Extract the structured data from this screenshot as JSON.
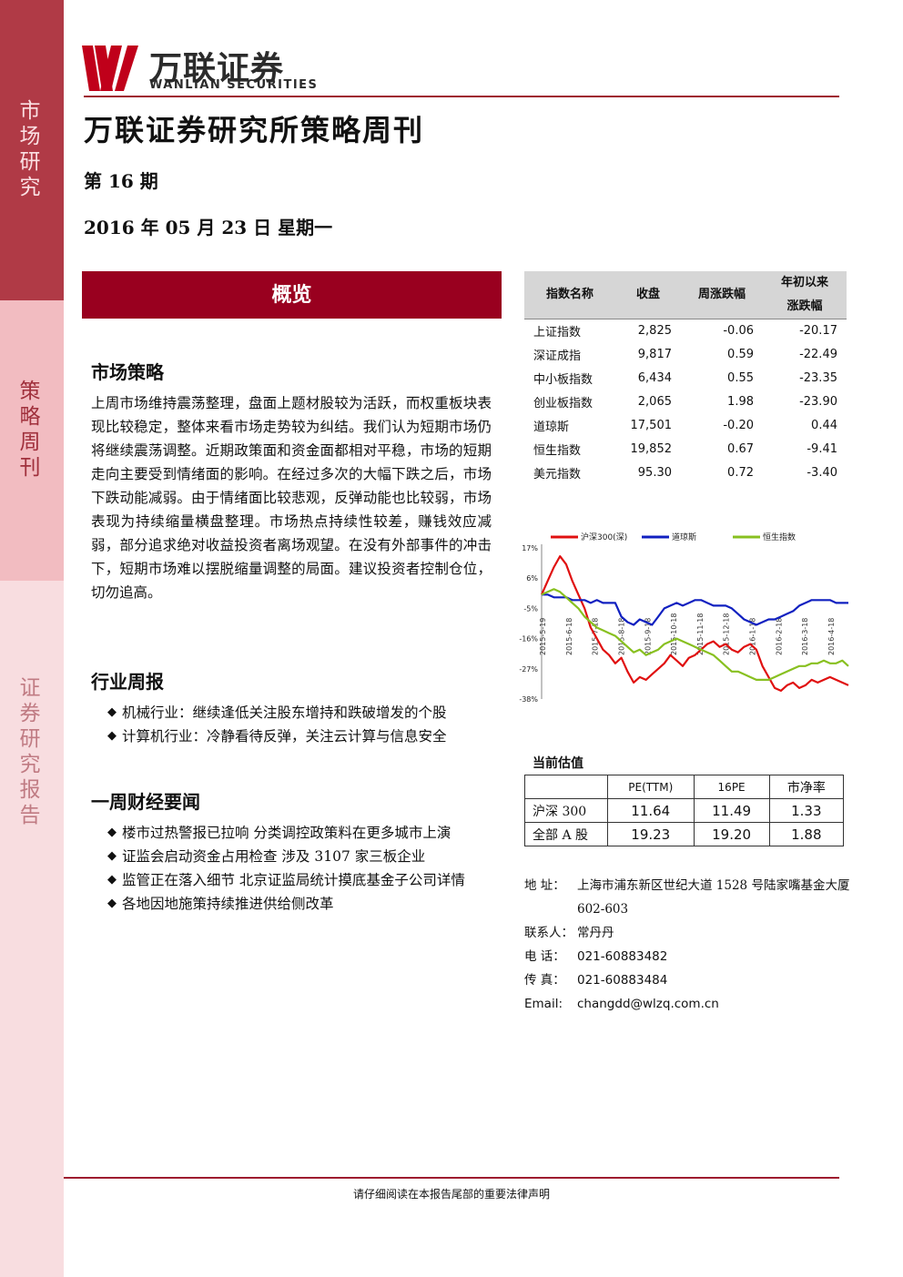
{
  "sidebar": {
    "labels": [
      [
        "市",
        "场",
        "研",
        "究"
      ],
      [
        "策",
        "略",
        "周",
        "刊"
      ],
      [
        "证",
        "券",
        "研",
        "究",
        "报",
        "告"
      ]
    ]
  },
  "header": {
    "brand_cn": "万联证券",
    "brand_en": "WANLIAN SECURITIES",
    "title": "万联证券研究所策略周刊",
    "issue": "第 16 期",
    "date": "2016 年 05 月 23 日  星期一"
  },
  "overview": {
    "banner": "概览"
  },
  "strategy": {
    "heading": "市场策略",
    "text": "上周市场维持震荡整理，盘面上题材股较为活跃，而权重板块表现比较稳定，整体来看市场走势较为纠结。我们认为短期市场仍将继续震荡调整。近期政策面和资金面都相对平稳，市场的短期走向主要受到情绪面的影响。在经过多次的大幅下跌之后，市场下跌动能减弱。由于情绪面比较悲观，反弹动能也比较弱，市场表现为持续缩量横盘整理。市场热点持续性较差，赚钱效应减弱，部分追求绝对收益投资者离场观望。在没有外部事件的冲击下，短期市场难以摆脱缩量调整的局面。建议投资者控制仓位，切勿追高。"
  },
  "industry": {
    "heading": "行业周报",
    "items": [
      "机械行业：继续逢低关注股东增持和跌破增发的个股",
      "计算机行业：冷静看待反弹，关注云计算与信息安全"
    ]
  },
  "news": {
    "heading": "一周财经要闻",
    "items": [
      "楼市过热警报已拉响 分类调控政策料在更多城市上演",
      "证监会启动资金占用检查 涉及 3107 家三板企业",
      "监管正在落入细节 北京证监局统计摸底基金子公司详情",
      "各地因地施策持续推进供给侧改革"
    ]
  },
  "index_table": {
    "headers": [
      "指数名称",
      "收盘",
      "周涨跌幅",
      "年初以来",
      "涨跌幅"
    ],
    "rows": [
      [
        "上证指数",
        "2,825",
        "-0.06",
        "-20.17"
      ],
      [
        "深证成指",
        "9,817",
        "0.59",
        "-22.49"
      ],
      [
        "中小板指数",
        "6,434",
        "0.55",
        "-23.35"
      ],
      [
        "创业板指数",
        "2,065",
        "1.98",
        "-23.90"
      ],
      [
        "道琼斯",
        "17,501",
        "-0.20",
        "0.44"
      ],
      [
        "恒生指数",
        "19,852",
        "0.67",
        "-9.41"
      ],
      [
        "美元指数",
        "95.30",
        "0.72",
        "-3.40"
      ]
    ]
  },
  "chart_data": {
    "type": "line",
    "y_ticks": [
      "17%",
      "6%",
      "-5%",
      "-16%",
      "-27%",
      "-38%"
    ],
    "ylim": [
      -38,
      17
    ],
    "x_ticks": [
      "2015-5-19",
      "2015-6-18",
      "2015-7-18",
      "2015-8-18",
      "2015-9-18",
      "2015-10-18",
      "2015-11-18",
      "2015-12-18",
      "2016-1-18",
      "2016-2-18",
      "2016-3-18",
      "2016-4-18"
    ],
    "series": [
      {
        "name": "沪深300(深)",
        "color": "#e01010",
        "values": [
          0,
          5,
          10,
          14,
          11,
          5,
          0,
          -5,
          -12,
          -16,
          -20,
          -22,
          -25,
          -23,
          -28,
          -32,
          -30,
          -31,
          -29,
          -27,
          -25,
          -22,
          -24,
          -26,
          -23,
          -22,
          -20,
          -18,
          -17,
          -19,
          -18,
          -20,
          -21,
          -19,
          -18,
          -20,
          -26,
          -30,
          -34,
          -35,
          -33,
          -32,
          -34,
          -33,
          -31,
          -32,
          -31,
          -30,
          -31,
          -32,
          -33
        ]
      },
      {
        "name": "道琼斯",
        "color": "#1020c0",
        "values": [
          0,
          0,
          -1,
          -1,
          -1,
          -2,
          -2,
          -2,
          -3,
          -2,
          -3,
          -3,
          -3,
          -8,
          -10,
          -11,
          -9,
          -10,
          -11,
          -8,
          -5,
          -4,
          -3,
          -4,
          -3,
          -2,
          -2,
          -3,
          -4,
          -4,
          -4,
          -5,
          -7,
          -9,
          -10,
          -11,
          -10,
          -9,
          -9,
          -8,
          -7,
          -6,
          -4,
          -3,
          -2,
          -2,
          -2,
          -2,
          -3,
          -3,
          -3
        ]
      },
      {
        "name": "恒生指数",
        "color": "#88c020",
        "values": [
          0,
          1,
          2,
          1,
          -1,
          -3,
          -5,
          -8,
          -10,
          -12,
          -13,
          -14,
          -15,
          -17,
          -19,
          -21,
          -20,
          -22,
          -21,
          -20,
          -18,
          -17,
          -16,
          -17,
          -18,
          -19,
          -20,
          -21,
          -22,
          -24,
          -26,
          -28,
          -28,
          -29,
          -30,
          -31,
          -31,
          -31,
          -30,
          -29,
          -28,
          -27,
          -26,
          -26,
          -25,
          -25,
          -24,
          -25,
          -25,
          -24,
          -26
        ]
      }
    ]
  },
  "valuation": {
    "heading": "当前估值",
    "headers": [
      "",
      "PE(TTM)",
      "16PE",
      "市净率"
    ],
    "rows": [
      [
        "沪深 300",
        "11.64",
        "11.49",
        "1.33"
      ],
      [
        "全部 A 股",
        "19.23",
        "19.20",
        "1.88"
      ]
    ]
  },
  "contact": {
    "address_label": "地    址：",
    "address": "上海市浦东新区世纪大道 1528 号陆家嘴基金大厦 602-603",
    "person_label": "联系人：",
    "person": "常丹丹",
    "phone_label": "电    话：",
    "phone": "021-60883482",
    "fax_label": "传    真：",
    "fax": "021-60883484",
    "email_label": "Email:",
    "email": "changdd@wlzq.com.cn"
  },
  "footer": {
    "note": "请仔细阅读在本报告尾部的重要法律声明"
  },
  "colors": {
    "brand": "#99001f",
    "band_dark": "#b03a46",
    "band_mid": "#f2bcc1",
    "band_light": "#f8dde0"
  }
}
